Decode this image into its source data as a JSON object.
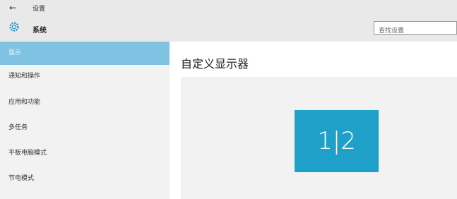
{
  "window": {
    "back_icon": "←",
    "title": "设置"
  },
  "header": {
    "icon": "gear-icon",
    "title": "系统",
    "search_placeholder": "查找设置"
  },
  "sidebar": {
    "items": [
      {
        "label": "显示",
        "selected": true
      },
      {
        "label": "通知和操作",
        "selected": false
      },
      {
        "label": "应用和功能",
        "selected": false
      },
      {
        "label": "多任务",
        "selected": false
      },
      {
        "label": "平板电脑模式",
        "selected": false
      },
      {
        "label": "节电模式",
        "selected": false
      }
    ]
  },
  "main": {
    "title": "自定义显示器",
    "monitor_label": "1|2"
  },
  "colors": {
    "accent": "#1fa0c8",
    "selected_bg": "#7fc2e2",
    "titlebar_bg": "#e9e9e9",
    "sidebar_bg": "#f2f2f2"
  }
}
